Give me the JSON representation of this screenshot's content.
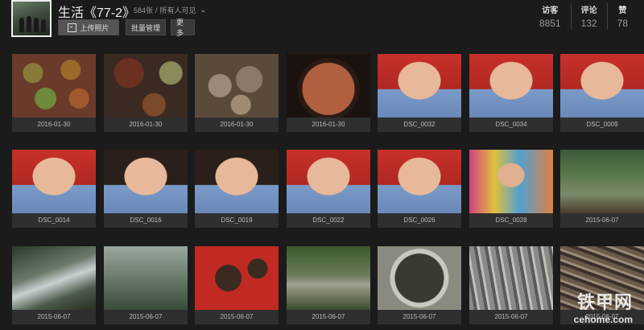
{
  "album": {
    "title": "生活《77-2》",
    "count": "584张",
    "visibility": "所有人可见",
    "visibility_icon": "chevron-down-icon"
  },
  "actions": {
    "upload_label": "上传照片",
    "manage_label": "批量管理",
    "more_label": "更多"
  },
  "stats": [
    {
      "label": "访客",
      "value": "8851"
    },
    {
      "label": "评论",
      "value": "132"
    },
    {
      "label": "赞",
      "value": "78"
    }
  ],
  "photos": [
    {
      "caption": "2016-01-30"
    },
    {
      "caption": "2016-01-30"
    },
    {
      "caption": "2016-01-30"
    },
    {
      "caption": "2016-01-30"
    },
    {
      "caption": "DSC_0032"
    },
    {
      "caption": "DSC_0034"
    },
    {
      "caption": "DSC_0009"
    },
    {
      "caption": "DSC_0014"
    },
    {
      "caption": "DSC_0016"
    },
    {
      "caption": "DSC_0019"
    },
    {
      "caption": "DSC_0022"
    },
    {
      "caption": "DSC_0026"
    },
    {
      "caption": "DSC_0028"
    },
    {
      "caption": "2015-06-07"
    },
    {
      "caption": "2015-06-07"
    },
    {
      "caption": "2015-06-07"
    },
    {
      "caption": "2015-06-07"
    },
    {
      "caption": "2015-06-07"
    },
    {
      "caption": "2015-06-07"
    },
    {
      "caption": "2015-06-07"
    },
    {
      "caption": "2015-06-07"
    }
  ],
  "watermark": {
    "text": "铁甲网",
    "url": "cehome.com"
  }
}
